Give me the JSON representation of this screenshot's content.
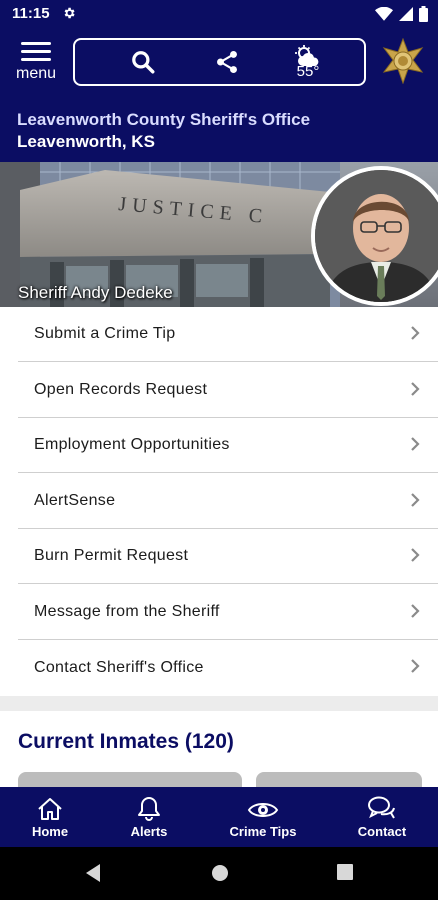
{
  "status_bar": {
    "time": "11:15"
  },
  "app_bar": {
    "menu_label": "menu",
    "weather_temp": "55°"
  },
  "agency": {
    "name": "Leavenworth County Sheriff's Office",
    "city": "Leavenworth, KS"
  },
  "hero": {
    "building_sign": "JUSTICE C",
    "caption": "Sheriff Andy Dedeke"
  },
  "menu": {
    "items": [
      {
        "label": "Submit a Crime Tip"
      },
      {
        "label": "Open Records Request"
      },
      {
        "label": "Employment Opportunities"
      },
      {
        "label": "AlertSense"
      },
      {
        "label": "Burn Permit Request"
      },
      {
        "label": "Message from the Sheriff"
      },
      {
        "label": "Contact Sheriff's Office"
      }
    ]
  },
  "inmates": {
    "title": "Current Inmates (120)"
  },
  "tabs": [
    {
      "label": "Home",
      "icon": "home-icon"
    },
    {
      "label": "Alerts",
      "icon": "bell-icon"
    },
    {
      "label": "Crime Tips",
      "icon": "eye-icon"
    },
    {
      "label": "Contact",
      "icon": "chat-bubbles-icon"
    }
  ],
  "colors": {
    "brand_navy": "#0b0d63",
    "title_tint": "#d9dcff"
  }
}
